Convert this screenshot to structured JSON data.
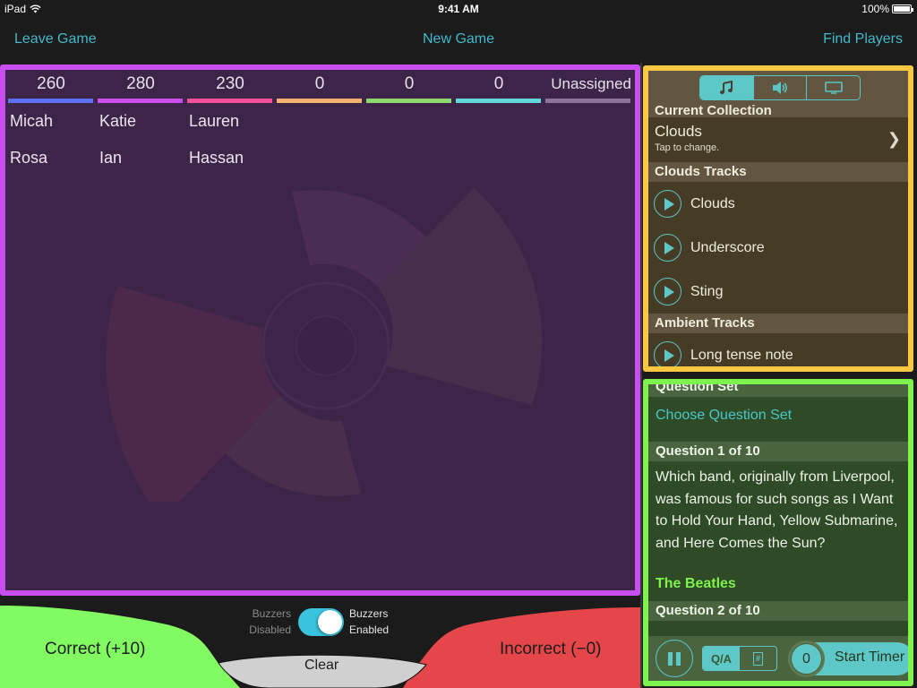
{
  "status_bar": {
    "device": "iPad",
    "time": "9:41 AM",
    "battery": "100%",
    "battery_level": 1.0
  },
  "nav": {
    "leave_game": "Leave Game",
    "new_game": "New Game",
    "find_players": "Find Players"
  },
  "teams": [
    {
      "score": "260",
      "color": "#5f70f2",
      "players": [
        "Micah",
        "Rosa"
      ]
    },
    {
      "score": "280",
      "color": "#c84ef0",
      "players": [
        "Katie",
        "Ian"
      ]
    },
    {
      "score": "230",
      "color": "#f2509a",
      "players": [
        "Lauren",
        "Hassan"
      ]
    },
    {
      "score": "0",
      "color": "#f2b270",
      "players": []
    },
    {
      "score": "0",
      "color": "#8ed870",
      "players": []
    },
    {
      "score": "0",
      "color": "#62d8d8",
      "players": []
    },
    {
      "score": "Unassigned",
      "color": "#8c7498",
      "players": []
    }
  ],
  "controls": {
    "correct": "Correct (+10)",
    "incorrect": "Incorrect (−0)",
    "clear": "Clear",
    "buzzers_disabled_1": "Buzzers",
    "buzzers_disabled_2": "Disabled",
    "buzzers_enabled_1": "Buzzers",
    "buzzers_enabled_2": "Enabled",
    "buzzers_on": true
  },
  "audio": {
    "tabs": [
      {
        "icon": "music-note-icon",
        "active": true
      },
      {
        "icon": "speaker-icon",
        "active": false
      },
      {
        "icon": "tv-icon",
        "active": false
      }
    ],
    "current_collection_header": "Current Collection",
    "collection_name": "Clouds",
    "collection_hint": "Tap to change.",
    "collection_tracks_header": "Clouds Tracks",
    "collection_tracks": [
      "Clouds",
      "Underscore",
      "Sting"
    ],
    "ambient_header": "Ambient Tracks",
    "ambient_tracks": [
      "Long tense note"
    ]
  },
  "questions": {
    "set_header": "Question Set",
    "choose_set": "Choose Question Set",
    "q1_header": "Question 1 of 10",
    "q1_text": "Which band, originally from Liverpool, was famous for such songs as I Want to Hold Your Hand, Yellow Submarine, and Here Comes the Sun?",
    "q1_answer": "The Beatles",
    "q2_header": "Question 2 of 10",
    "mode_qa": "Q/A",
    "mode_hash": "#",
    "timer_value": "0",
    "start_timer": "Start Timer"
  }
}
